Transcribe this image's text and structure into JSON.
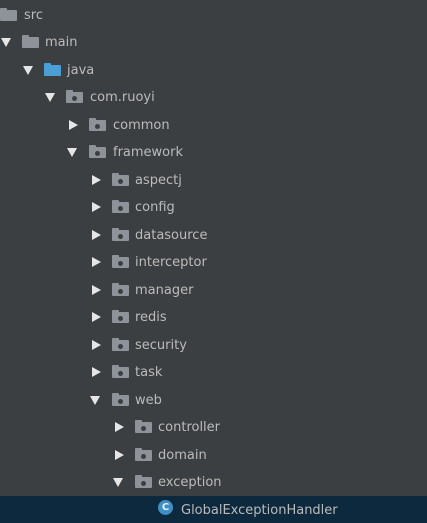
{
  "tree": {
    "nodes": [
      {
        "label": "src",
        "icon": "folder-icon"
      },
      {
        "label": "main",
        "icon": "folder-icon",
        "expanded": true
      },
      {
        "label": "java",
        "icon": "source-folder-icon",
        "expanded": true
      },
      {
        "label": "com.ruoyi",
        "icon": "package-icon",
        "expanded": true
      },
      {
        "label": "common",
        "icon": "package-icon",
        "expanded": false
      },
      {
        "label": "framework",
        "icon": "package-icon",
        "expanded": true
      },
      {
        "label": "aspectj",
        "icon": "package-icon",
        "expanded": false
      },
      {
        "label": "config",
        "icon": "package-icon",
        "expanded": false
      },
      {
        "label": "datasource",
        "icon": "package-icon",
        "expanded": false
      },
      {
        "label": "interceptor",
        "icon": "package-icon",
        "expanded": false
      },
      {
        "label": "manager",
        "icon": "package-icon",
        "expanded": false
      },
      {
        "label": "redis",
        "icon": "package-icon",
        "expanded": false
      },
      {
        "label": "security",
        "icon": "package-icon",
        "expanded": false
      },
      {
        "label": "task",
        "icon": "package-icon",
        "expanded": false
      },
      {
        "label": "web",
        "icon": "package-icon",
        "expanded": true
      },
      {
        "label": "controller",
        "icon": "package-icon",
        "expanded": false
      },
      {
        "label": "domain",
        "icon": "package-icon",
        "expanded": false
      },
      {
        "label": "exception",
        "icon": "package-icon",
        "expanded": true
      },
      {
        "label": "GlobalExceptionHandler",
        "icon": "class-icon",
        "class_letter": "C",
        "selected": true
      }
    ]
  },
  "colors": {
    "background": "#3c3f41",
    "selection": "#0d293e",
    "text": "#bbbbbb",
    "folder": "#8d9399",
    "source_folder": "#4a9fd4",
    "class_icon": "#3d8fc6"
  }
}
